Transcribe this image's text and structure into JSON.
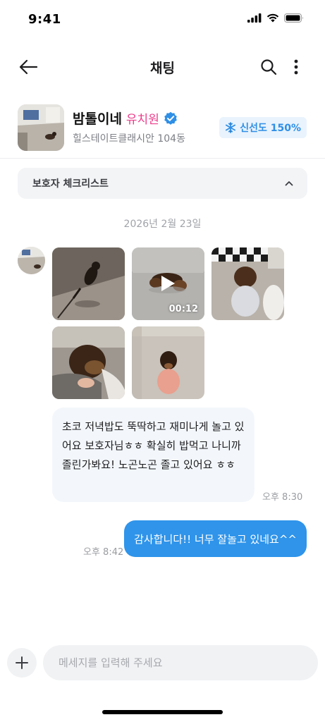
{
  "status_bar": {
    "time": "9:41"
  },
  "header": {
    "title": "채팅"
  },
  "profile": {
    "name": "밤톨이네",
    "type": "유치원",
    "address": "힐스테이트클래시안 104동",
    "badge_label": "신선도 150%"
  },
  "checklist": {
    "label": "보호자 체크리스트"
  },
  "conversation": {
    "date": "2026년 2월 23일",
    "photos": [
      {
        "kind": "photo"
      },
      {
        "kind": "video",
        "duration": "00:12"
      },
      {
        "kind": "photo"
      },
      {
        "kind": "photo"
      },
      {
        "kind": "photo"
      }
    ],
    "incoming_message": {
      "text": "초코 저녁밥도 뚝딱하고 재미나게 놀고 있어요 보호자님ㅎㅎ 확실히 밥먹고 나니까 졸린가봐요! 노곤노곤 졸고 있어요 ㅎㅎ",
      "time": "오후 8:30"
    },
    "outgoing_message": {
      "text": "감사합니다!! 너무 잘놀고 있네요^^",
      "time": "오후 8:42"
    }
  },
  "composer": {
    "placeholder": "메세지를 입력해 주세요"
  },
  "colors": {
    "accent_blue": "#2f94ea",
    "verified_blue": "#2f8fe6",
    "kindergarten_pink": "#ec3d8b",
    "incoming_bubble": "#f3f7fb"
  }
}
